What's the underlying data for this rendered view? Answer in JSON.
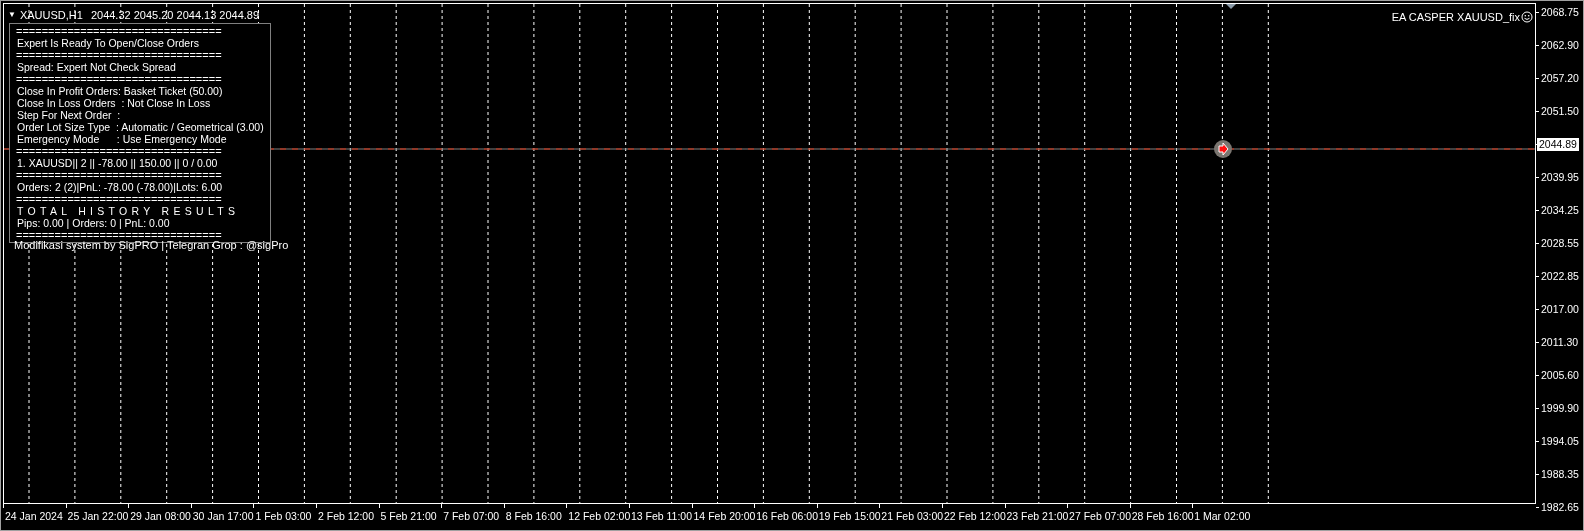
{
  "chart_header": {
    "collapse_glyph": "▼",
    "symbol": "XAUUSD,H1",
    "ohlc": "2044.32 2045.20 2044.13 2044.89"
  },
  "expert_name": "EA CASPER XAUUSD_fix",
  "info_panel": {
    "lines": [
      {
        "kind": "rule",
        "text": "================================"
      },
      {
        "kind": "text",
        "text": "Expert Is Ready To Open/Close Orders"
      },
      {
        "kind": "rule",
        "text": "================================"
      },
      {
        "kind": "text",
        "text": "Spread: Expert Not Check Spread"
      },
      {
        "kind": "rule",
        "text": "================================"
      },
      {
        "kind": "text",
        "text": "Close In Profit Orders: Basket Ticket (50.00)"
      },
      {
        "kind": "text",
        "text": "Close In Loss Orders  : Not Close In Loss"
      },
      {
        "kind": "text",
        "text": "Step For Next Order  :"
      },
      {
        "kind": "text",
        "text": "Order Lot Size Type  : Automatic / Geometrical (3.00)"
      },
      {
        "kind": "text",
        "text": "Emergency Mode      : Use Emergency Mode"
      },
      {
        "kind": "rule",
        "text": "================================"
      },
      {
        "kind": "text",
        "text": "1. XAUUSD|| 2 || -78.00 || 150.00 || 0 / 0.00"
      },
      {
        "kind": "rule",
        "text": "================================"
      },
      {
        "kind": "text",
        "text": "Orders: 2 (2)|PnL: -78.00 (-78.00)|Lots: 6.00"
      },
      {
        "kind": "rule",
        "text": "================================"
      },
      {
        "kind": "heading",
        "text": "TOTAL HISTORY RESULTS"
      },
      {
        "kind": "text",
        "text": "Pips: 0.00 | Orders: 0 | PnL: 0.00"
      },
      {
        "kind": "rule",
        "text": "================================"
      }
    ]
  },
  "footer_note": "Modifikasi system by SigPRO | Telegran Grop : @sigPro",
  "current_price": "2044.89",
  "price_axis": [
    "2068.75",
    "2062.90",
    "2057.20",
    "2051.50",
    "2039.95",
    "2034.25",
    "2028.55",
    "2022.85",
    "2017.00",
    "2011.30",
    "2005.60",
    "1999.90",
    "1994.05",
    "1988.35",
    "1982.65"
  ],
  "time_axis": [
    "24 Jan 2024",
    "25 Jan 22:00",
    "29 Jan 08:00",
    "30 Jan 17:00",
    "1 Feb 03:00",
    "2 Feb 12:00",
    "5 Feb 21:00",
    "7 Feb 07:00",
    "8 Feb 16:00",
    "12 Feb 02:00",
    "13 Feb 11:00",
    "14 Feb 20:00",
    "16 Feb 06:00",
    "19 Feb 15:00",
    "21 Feb 03:00",
    "22 Feb 12:00",
    "23 Feb 21:00",
    "27 Feb 07:00",
    "28 Feb 16:00",
    "1 Mar 02:00"
  ]
}
